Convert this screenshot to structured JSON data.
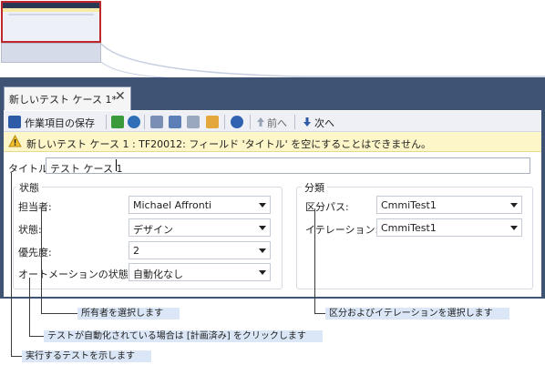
{
  "tab": {
    "title": "新しいテスト ケース 1*",
    "close_glyph": "✕"
  },
  "toolbar": {
    "save_label": "作業項目の保存",
    "prev_label": "前へ",
    "next_label": "次へ",
    "icons": [
      "save-icon",
      "refresh-icon",
      "undo-icon",
      "link-icon",
      "copy-icon",
      "new-item-icon",
      "check-icon",
      "help-icon",
      "up-arrow-icon",
      "down-arrow-icon"
    ]
  },
  "warning": {
    "message": "新しいテスト ケース 1 : TF20012: フィールド 'タイトル' を空にすることはできません。",
    "icon": "warning-icon"
  },
  "title_field": {
    "label": "タイトル:",
    "value": "テスト ケース 1"
  },
  "status_group": {
    "title": "状態",
    "fields": [
      {
        "label": "担当者:",
        "value": "Michael Affronti"
      },
      {
        "label": "状態:",
        "value": "デザイン"
      },
      {
        "label": "優先度:",
        "value": "2"
      },
      {
        "label": "オートメーションの状態:",
        "value": "自動化なし"
      }
    ]
  },
  "classification_group": {
    "title": "分類",
    "fields": [
      {
        "label": "区分パス:",
        "value": "CmmiTest1"
      },
      {
        "label": "イテレーション:",
        "value": "CmmiTest1"
      }
    ]
  },
  "callouts": {
    "owner": "所有者を選択します",
    "area": "区分およびイテレーションを選択します",
    "automated": "テストが自動化されている場合は [計画済み] をクリックします",
    "shows": "実行するテストを示します"
  },
  "colors": {
    "window": "#3f5375",
    "highlight": "#c0262b",
    "warning_bg": "#fdf6c8",
    "callout_bg": "#dbe7f7"
  }
}
